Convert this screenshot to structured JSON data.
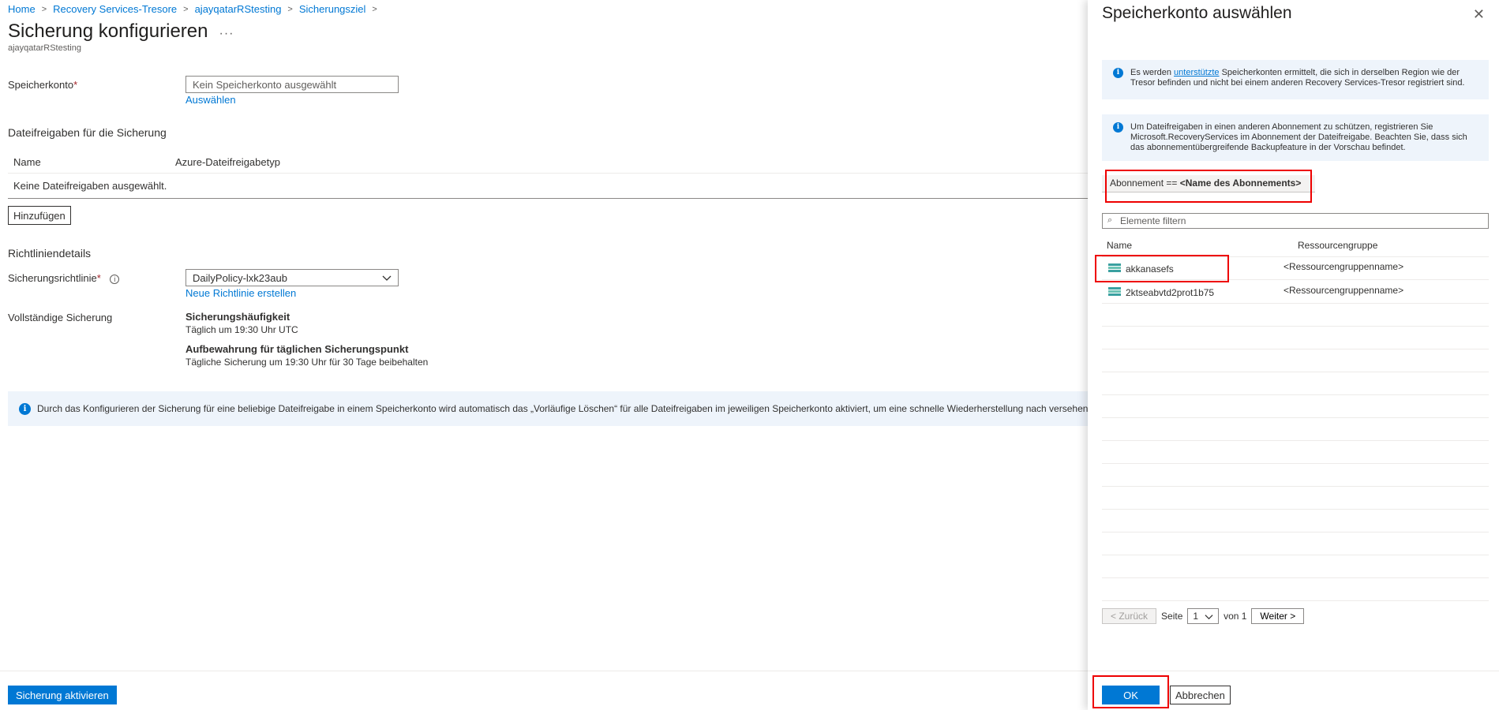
{
  "breadcrumb": {
    "items": [
      "Home",
      "Recovery Services-Tresore",
      "ajayqatarRStesting",
      "Sicherungsziel"
    ]
  },
  "page": {
    "title": "Sicherung konfigurieren",
    "more": "···",
    "subtitle": "ajayqatarRStesting"
  },
  "storage_account": {
    "label": "Speicherkonto",
    "required_mark": "*",
    "placeholder": "Kein Speicherkonto ausgewählt",
    "select_link": "Auswählen"
  },
  "file_shares": {
    "title": "Dateifreigaben für die Sicherung",
    "columns": [
      "Name",
      "Azure-Dateifreigabetyp"
    ],
    "empty_text": "Keine Dateifreigaben ausgewählt.",
    "add_button": "Hinzufügen"
  },
  "policy": {
    "title": "Richtliniendetails",
    "label": "Sicherungsrichtlinie",
    "required_mark": "*",
    "info_glyph": "i",
    "selected": "DailyPolicy-lxk23aub",
    "new_link": "Neue Richtlinie erstellen",
    "full_backup_label": "Vollständige Sicherung",
    "frequency_title": "Sicherungshäufigkeit",
    "frequency_value": "Täglich um 19:30 Uhr UTC",
    "retention_title": "Aufbewahrung für täglichen Sicherungspunkt",
    "retention_value": "Tägliche Sicherung um 19:30 Uhr für 30 Tage beibehalten"
  },
  "info_bar": {
    "text": "Durch das Konfigurieren der Sicherung für eine beliebige Dateifreigabe in einem Speicherkonto wird automatisch das „Vorläufige Löschen“ für alle Dateifreigaben im jeweiligen Speicherkonto aktiviert, um eine schnelle Wiederherstellung nach versehentlichem Löschen von Dateifreigaben zu ermöglichen."
  },
  "footer": {
    "enable_button": "Sicherung aktivieren"
  },
  "panel": {
    "title": "Speicherkonto auswählen",
    "close_glyph": "✕",
    "msg1_pre": "Es werden ",
    "msg1_link": "unterstützte",
    "msg1_post": " Speicherkonten ermittelt, die sich in derselben Region wie der Tresor befinden und nicht bei einem anderen Recovery Services-Tresor registriert sind.",
    "msg2": "Um Dateifreigaben in einen anderen Abonnement zu schützen, registrieren Sie Microsoft.RecoveryServices im Abonnement der Dateifreigabe. Beachten Sie, dass sich das abonnementübergreifende Backupfeature in der Vorschau befindet.",
    "filter_prefix": "Abonnement == ",
    "filter_value": "<Name des Abonnements>",
    "search_placeholder": "Elemente filtern",
    "columns": [
      "Name",
      "Ressourcengruppe"
    ],
    "rows": [
      {
        "name": "akkanasefs",
        "rg": "<Ressourcengruppenname>"
      },
      {
        "name": "2ktseabvtd2prot1b75",
        "rg": "<Ressourcengruppenname>"
      }
    ],
    "pager": {
      "prev": "< Zurück",
      "page_label": "Seite",
      "page_value": "1",
      "of_label": "von 1",
      "next": "Weiter >"
    },
    "ok_button": "OK",
    "cancel_button": "Abbrechen"
  },
  "colors": {
    "accent": "#0078d4",
    "highlight": "#e00000",
    "info_bg": "#eef4fb"
  }
}
